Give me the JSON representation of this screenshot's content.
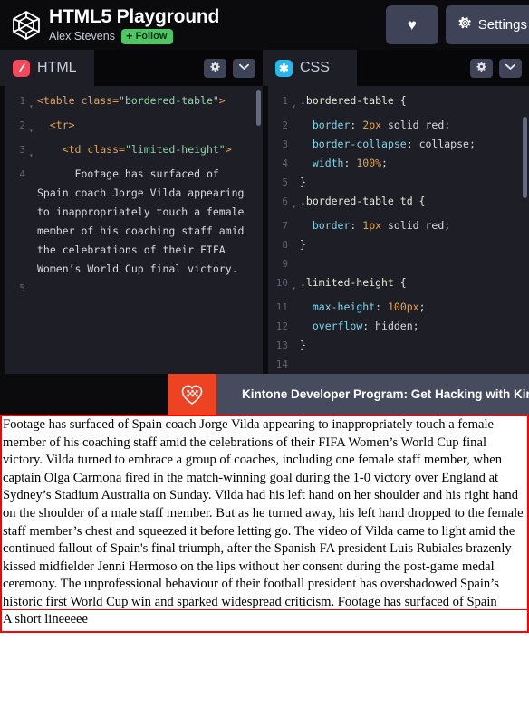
{
  "header": {
    "logo_icon": "cube-wireframe-logo",
    "app_title": "HTML5 Playground",
    "author": "Alex Stevens",
    "follow_label": "Follow",
    "follow_plus": "+",
    "favorite_icon": "heart-icon",
    "favorite_glyph": "♥",
    "settings_label": "Settings",
    "settings_icon": "gear-icon",
    "settings_glyph": "⚙",
    "colors": {
      "follow_green": "#4cc764",
      "button_slate": "#3f4357",
      "background": "#0b0b0d"
    }
  },
  "panels": {
    "html": {
      "tab_label": "HTML",
      "tab_icon": "html5-icon",
      "tab_icon_glyph": "/",
      "tab_icon_color": "#f2495c",
      "settings_icon": "gear-icon",
      "collapse_icon": "chevron-down-icon",
      "lines": [
        {
          "no": "1",
          "fold": true,
          "segs": [
            {
              "t": "tag",
              "v": "<table "
            },
            {
              "t": "attr",
              "v": "class="
            },
            {
              "t": "str",
              "v": "\"bordered-table\""
            },
            {
              "t": "tag",
              "v": ">"
            }
          ]
        },
        {
          "no": "2",
          "fold": true,
          "segs": [
            {
              "t": "txt",
              "v": "  "
            },
            {
              "t": "tag",
              "v": "<tr>"
            }
          ]
        },
        {
          "no": "3",
          "fold": true,
          "segs": [
            {
              "t": "txt",
              "v": "    "
            },
            {
              "t": "tag",
              "v": "<td "
            },
            {
              "t": "attr",
              "v": "class="
            },
            {
              "t": "str",
              "v": "\"limited-height\""
            },
            {
              "t": "tag",
              "v": ">"
            }
          ]
        },
        {
          "no": "4",
          "fold": false,
          "segs": [
            {
              "t": "txt",
              "v": "      Footage has surfaced of Spain coach Jorge Vilda appearing to inappropriately touch a female member of his coaching staff amid the celebrations of their FIFA Women’s World Cup final victory."
            }
          ]
        },
        {
          "no": "5",
          "fold": false,
          "segs": []
        }
      ]
    },
    "css": {
      "tab_label": "CSS",
      "tab_icon": "css3-icon",
      "tab_icon_glyph": "✱",
      "tab_icon_color": "#22b8f0",
      "settings_icon": "gear-icon",
      "collapse_icon": "chevron-down-icon",
      "lines": [
        {
          "no": "1",
          "fold": true,
          "segs": [
            {
              "t": "sel",
              "v": ".bordered-table {"
            }
          ]
        },
        {
          "no": "2",
          "fold": false,
          "segs": [
            {
              "t": "txt",
              "v": "  "
            },
            {
              "t": "prop",
              "v": "border"
            },
            {
              "t": "punc",
              "v": ": "
            },
            {
              "t": "val",
              "v": "2px"
            },
            {
              "t": "punc",
              "v": " solid red;"
            }
          ]
        },
        {
          "no": "3",
          "fold": false,
          "segs": [
            {
              "t": "txt",
              "v": "  "
            },
            {
              "t": "prop",
              "v": "border-collapse"
            },
            {
              "t": "punc",
              "v": ": collapse;"
            }
          ]
        },
        {
          "no": "4",
          "fold": false,
          "segs": [
            {
              "t": "txt",
              "v": "  "
            },
            {
              "t": "prop",
              "v": "width"
            },
            {
              "t": "punc",
              "v": ": "
            },
            {
              "t": "val",
              "v": "100%"
            },
            {
              "t": "punc",
              "v": ";"
            }
          ]
        },
        {
          "no": "5",
          "fold": false,
          "segs": [
            {
              "t": "punc",
              "v": "}"
            }
          ]
        },
        {
          "no": "6",
          "fold": true,
          "segs": [
            {
              "t": "sel",
              "v": ".bordered-table td {"
            }
          ]
        },
        {
          "no": "7",
          "fold": false,
          "segs": [
            {
              "t": "txt",
              "v": "  "
            },
            {
              "t": "prop",
              "v": "border"
            },
            {
              "t": "punc",
              "v": ": "
            },
            {
              "t": "val",
              "v": "1px"
            },
            {
              "t": "punc",
              "v": " solid red;"
            }
          ]
        },
        {
          "no": "8",
          "fold": false,
          "segs": [
            {
              "t": "punc",
              "v": "}"
            }
          ]
        },
        {
          "no": "9",
          "fold": false,
          "segs": []
        },
        {
          "no": "10",
          "fold": true,
          "segs": [
            {
              "t": "sel",
              "v": ".limited-height {"
            }
          ]
        },
        {
          "no": "11",
          "fold": false,
          "segs": [
            {
              "t": "txt",
              "v": "  "
            },
            {
              "t": "prop",
              "v": "max-height"
            },
            {
              "t": "punc",
              "v": ": "
            },
            {
              "t": "val",
              "v": "100px"
            },
            {
              "t": "punc",
              "v": ";"
            }
          ]
        },
        {
          "no": "12",
          "fold": false,
          "segs": [
            {
              "t": "txt",
              "v": "  "
            },
            {
              "t": "prop",
              "v": "overflow"
            },
            {
              "t": "punc",
              "v": ": hidden;"
            }
          ]
        },
        {
          "no": "13",
          "fold": false,
          "segs": [
            {
              "t": "punc",
              "v": "}"
            }
          ]
        },
        {
          "no": "14",
          "fold": false,
          "segs": []
        }
      ]
    }
  },
  "banner": {
    "logo_icon": "kintone-heart-logo",
    "text": "Kintone Developer Program: Get Hacking with Kintone",
    "logo_bg": "#ee4323",
    "body_bg": "#474b5e"
  },
  "output": {
    "border_color": "red",
    "rows": [
      {
        "cell": "Footage has surfaced of Spain coach Jorge Vilda appearing to inappropriately touch a female member of his coaching staff amid the celebrations of their FIFA Women’s World Cup final victory. Vilda turned to embrace a group of coaches, including one female staff member, when captain Olga Carmona fired in the match-winning goal during the 1-0 victory over England at Sydney’s Stadium Australia on Sunday. Vilda had his left hand on her shoulder and his right hand on the shoulder of a male staff member. But as he turned away, his left hand dropped to the female staff member’s chest and squeezed it before letting go. The video of Vilda came to light amid the continued fallout of Spain's final triumph, after the Spanish FA president Luis Rubiales brazenly kissed midfielder Jenni Hermoso on the lips without her consent during the post-game medal ceremony. The unprofessional behaviour of their football president has overshadowed Spain’s historic first World Cup win and sparked widespread criticism. Footage has surfaced of Spain coach Jorge Vilda appearing to inappropriately touch a female member of his coaching staff amid the celebrations of their FIFA Women’s World Cup final victory. Vilda turned to embrace a group of coaches, including one female staff member, when captain Olga Carmona fired in the match-winning goal during the 1-0 victory over England at Sydney’s Stadium Australia on Sunday. Vilda had his left hand on her shoulder and his right hand on the shoulder of a male staff member. But as he turned away, his left hand dropped to the female staff member’s chest and squeezed it before letting go. The video of Vilda came to light amid the continued fallout of Spain's final triumph, after the Spanish FA president Luis Rubiales brazenly kissed midfielder Jenni Hermoso on the lips without her consent during the post-game medal ceremony. The unprofessional behaviour of their football president has overshadowed Spain’s historic first World Cup win and sparked widespread criticism."
      },
      {
        "cell": "A short lineeeee"
      }
    ]
  }
}
